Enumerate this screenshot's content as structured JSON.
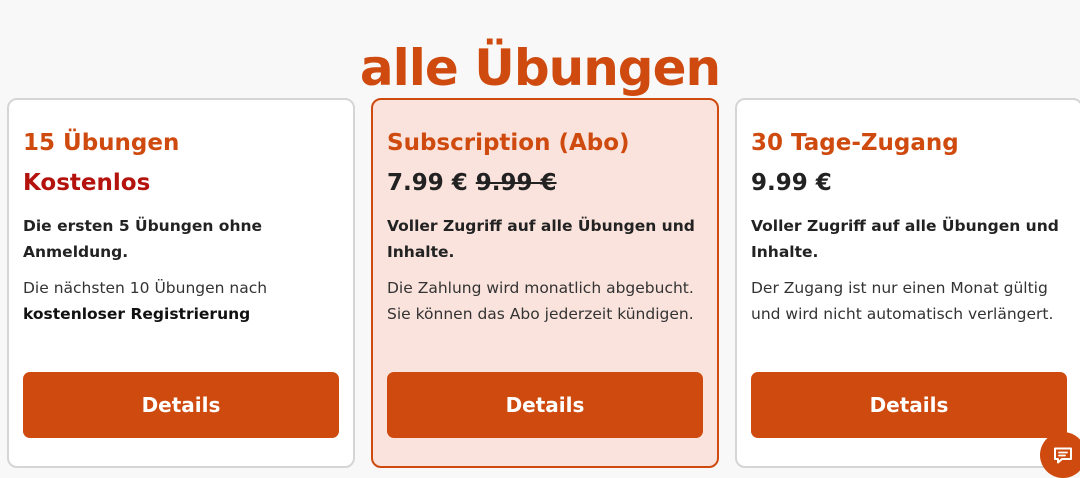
{
  "page": {
    "title": "alle Übungen"
  },
  "cards": [
    {
      "title": "15 Übungen",
      "price": "Kostenlos",
      "lead": "Die ersten 5 Übungen ohne Anmeldung.",
      "text_prefix": "Die nächsten 10 Übungen nach",
      "text_bold": "kostenloser Registrierung",
      "button": "Details"
    },
    {
      "title": "Subscription (Abo)",
      "price": "7.99 €",
      "old_price": "9.99 €",
      "lead": "Voller Zugriff auf alle Übungen und Inhalte.",
      "text": "Die Zahlung wird monatlich abgebucht. Sie können das Abo jederzeit kündigen.",
      "button": "Details"
    },
    {
      "title": "30 Tage-Zugang",
      "price": "9.99 €",
      "lead": "Voller Zugriff auf alle Übungen und Inhalte.",
      "text": "Der Zugang ist nur einen Monat gültig und wird nicht automatisch verlängert.",
      "button": "Details"
    }
  ],
  "chat": {
    "icon": "chat-icon"
  },
  "colors": {
    "accent": "#cf4a0e",
    "free_price": "#b4130d",
    "featured_background": "#fae3dc"
  }
}
